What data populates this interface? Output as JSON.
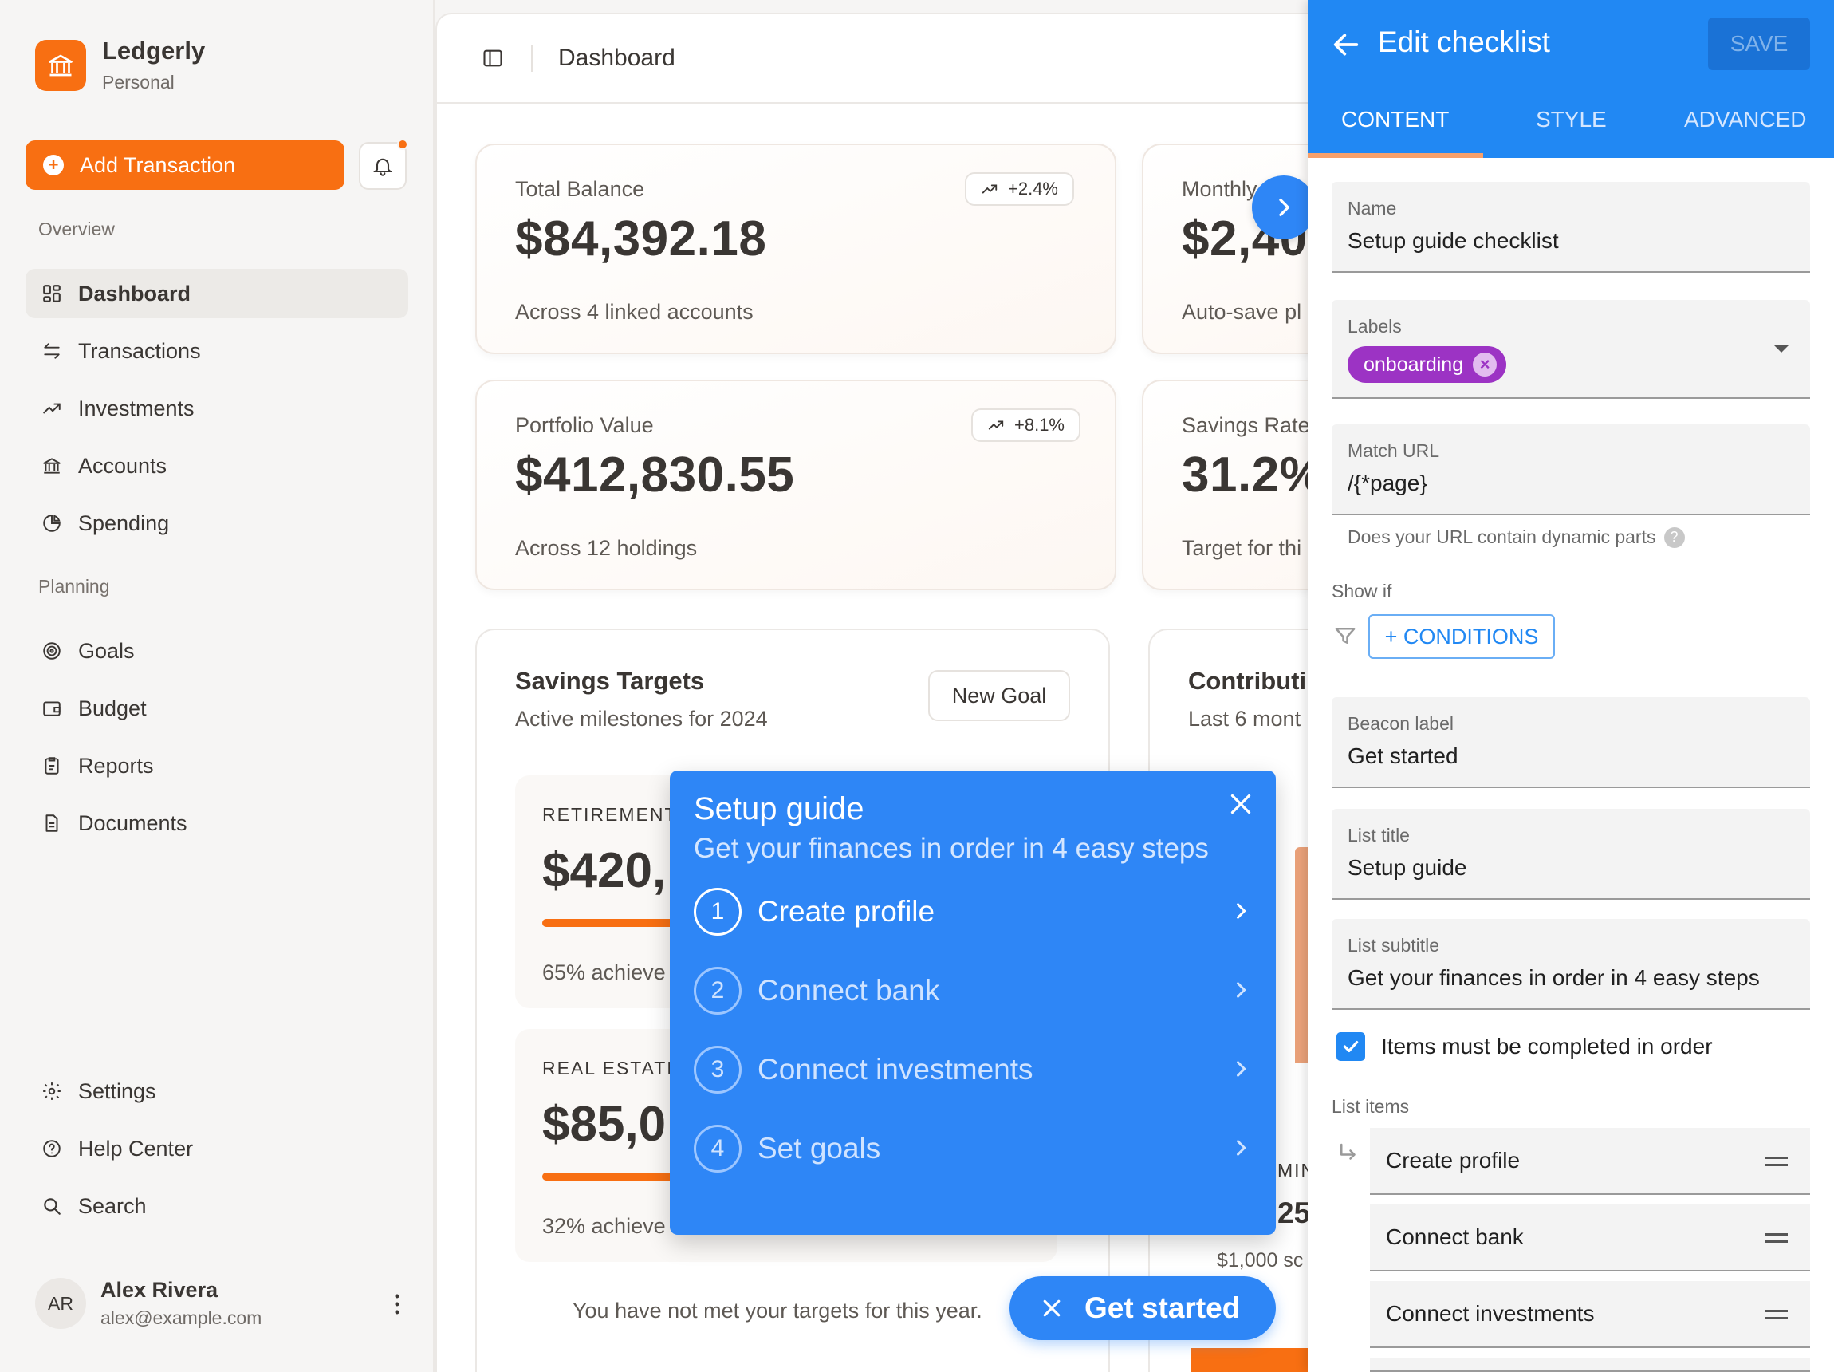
{
  "brand": {
    "name": "Ledgerly",
    "subtitle": "Personal"
  },
  "actions": {
    "add_transaction": "Add Transaction",
    "plus": "+"
  },
  "nav": {
    "overview_label": "Overview",
    "planning_label": "Planning",
    "overview": [
      {
        "label": "Dashboard",
        "icon": "dashboard-icon",
        "active": true
      },
      {
        "label": "Transactions",
        "icon": "transfer-icon"
      },
      {
        "label": "Investments",
        "icon": "trending-up-icon"
      },
      {
        "label": "Accounts",
        "icon": "bank-icon"
      },
      {
        "label": "Spending",
        "icon": "pie-chart-icon"
      }
    ],
    "planning": [
      {
        "label": "Goals",
        "icon": "target-icon"
      },
      {
        "label": "Budget",
        "icon": "wallet-icon"
      },
      {
        "label": "Reports",
        "icon": "clipboard-icon"
      },
      {
        "label": "Documents",
        "icon": "document-icon"
      }
    ],
    "footer": [
      {
        "label": "Settings",
        "icon": "gear-icon"
      },
      {
        "label": "Help Center",
        "icon": "help-icon"
      },
      {
        "label": "Search",
        "icon": "search-icon"
      }
    ]
  },
  "user": {
    "initials": "AR",
    "name": "Alex Rivera",
    "email": "alex@example.com"
  },
  "header": {
    "title": "Dashboard"
  },
  "stats": [
    {
      "label": "Total Balance",
      "value": "$84,392.18",
      "note": "Across 4 linked accounts",
      "change": "+2.4%"
    },
    {
      "label": "Monthly",
      "value": "$2,40",
      "note": "Auto-save pl"
    },
    {
      "label": "Portfolio Value",
      "value": "$412,830.55",
      "note": "Across 12 holdings",
      "change": "+8.1%"
    },
    {
      "label": "Savings Rate",
      "value": "31.2%",
      "note": "Target for thi"
    }
  ],
  "savings": {
    "title": "Savings Targets",
    "subtitle": "Active milestones for 2024",
    "new_goal": "New Goal",
    "goals": [
      {
        "category": "RETIREMENT",
        "value": "$420,",
        "note": "65% achieve",
        "progress": 0.65
      },
      {
        "category": "REAL ESTATE",
        "value": "$85,0",
        "note": "32% achieve",
        "progress": 0.32
      }
    ],
    "message": "You have not met your targets for this year."
  },
  "contrib": {
    "title": "Contributi",
    "subtitle": "Last 6 mont",
    "min_label": "MIN",
    "min_value": "25",
    "min_note": "$1,000 sc"
  },
  "checklist": {
    "title": "Setup guide",
    "subtitle": "Get your finances in order in 4 easy steps",
    "items": [
      {
        "num": "1",
        "label": "Create profile"
      },
      {
        "num": "2",
        "label": "Connect bank"
      },
      {
        "num": "3",
        "label": "Connect investments"
      },
      {
        "num": "4",
        "label": "Set goals"
      }
    ],
    "beacon": "Get started"
  },
  "editor": {
    "title": "Edit checklist",
    "save": "SAVE",
    "tabs": [
      "CONTENT",
      "STYLE",
      "ADVANCED"
    ],
    "name_label": "Name",
    "name_value": "Setup guide checklist",
    "labels_label": "Labels",
    "label_chip": "onboarding",
    "match_label": "Match URL",
    "match_value": "/{*page}",
    "match_helper": "Does your URL contain dynamic parts",
    "show_if": "Show if",
    "conditions": "+ CONDITIONS",
    "beacon_label": "Beacon label",
    "beacon_value": "Get started",
    "list_title_label": "List title",
    "list_title_value": "Setup guide",
    "list_subtitle_label": "List subtitle",
    "list_subtitle_value": "Get your finances in order in 4 easy steps",
    "in_order": "Items must be completed in order",
    "list_items_label": "List items",
    "list_items": [
      "Create profile",
      "Connect bank",
      "Connect investments"
    ]
  },
  "colors": {
    "brand": "#f86f12",
    "primary_blue": "#2188f3",
    "widget_blue": "#2e86f6",
    "chip_purple": "#9c33c4"
  }
}
